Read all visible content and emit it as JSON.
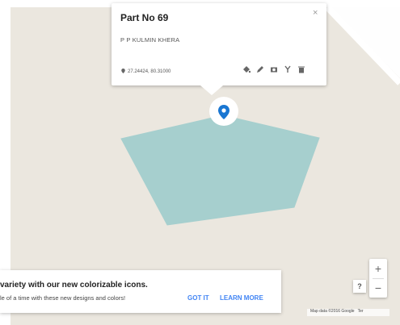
{
  "info_window": {
    "title": "Part No 69",
    "close_symbol": "×",
    "subtitle": "P P KULMIN KHERA",
    "coordinates": "27.24424, 80.31000",
    "tools": [
      "paint-bucket-icon",
      "pencil-icon",
      "camera-icon",
      "route-icon",
      "trash-icon"
    ]
  },
  "banner": {
    "line1": "variety with our new colorizable icons.",
    "line2": "le of a time with these new designs and colors!",
    "got_it": "GOT IT",
    "learn_more": "LEARN MORE"
  },
  "controls": {
    "zoom_in": "+",
    "zoom_out": "−",
    "help": "?"
  },
  "attribution": {
    "map_data": "Map data ©2016 Google",
    "terms": "Ter"
  },
  "colors": {
    "map_background": "#ebe7df",
    "polygon_fill": "#a6cfce",
    "marker": "#1976d2",
    "road": "#ffffff",
    "accent": "#4285f4"
  }
}
